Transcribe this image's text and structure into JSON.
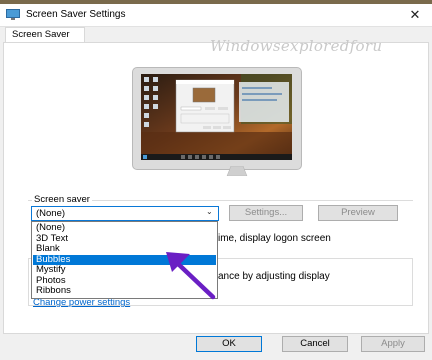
{
  "window": {
    "title": "Screen Saver Settings",
    "close_glyph": "✕"
  },
  "tab": {
    "label": "Screen Saver"
  },
  "watermark": "Windowsexploredforu",
  "screen_saver": {
    "section_label": "Screen saver",
    "selected": "(None)",
    "options": [
      "(None)",
      "3D Text",
      "Blank",
      "Bubbles",
      "Mystify",
      "Photos",
      "Ribbons"
    ],
    "highlighted_index": 3,
    "settings_label": "Settings...",
    "preview_label": "Preview",
    "resume_partial": "ime, display logon screen"
  },
  "power": {
    "partial_text": "ance by adjusting display",
    "link_label": "Change power settings"
  },
  "footer": {
    "ok_label": "OK",
    "cancel_label": "Cancel",
    "apply_label": "Apply"
  },
  "colors": {
    "accent": "#0078d7",
    "arrow": "#6a1fc4",
    "link": "#0066cc"
  }
}
